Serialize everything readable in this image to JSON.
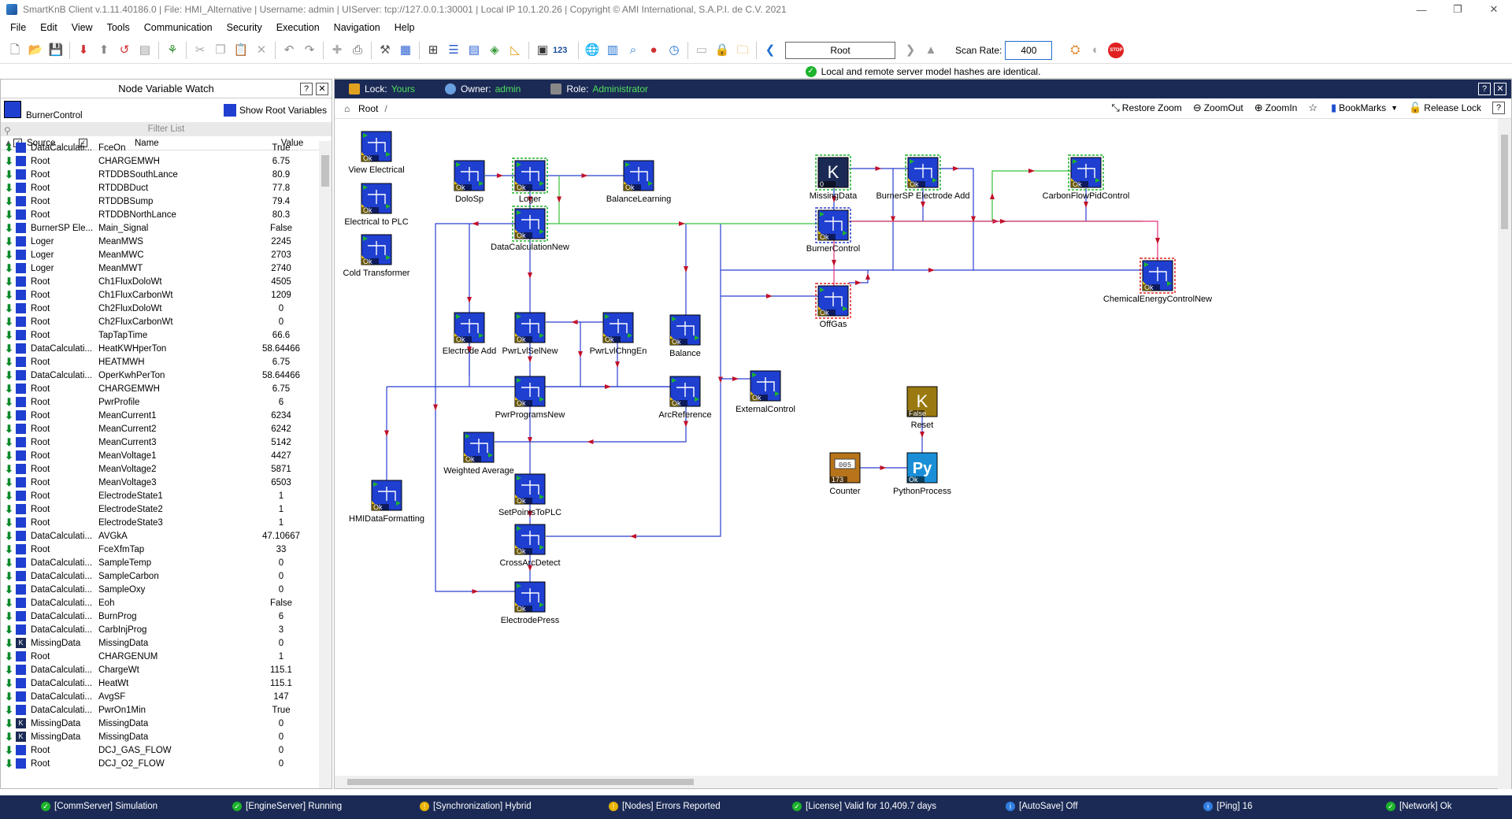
{
  "titlebar": {
    "text": "SmartKnB Client v.1.11.40186.0  |  File: HMI_Alternative  |  Username: admin  |  UIServer: tcp://127.0.0.1:30001  |  Local IP 10.1.20.26  |  Copyright ©  AMI International, S.A.P.I. de C.V. 2021",
    "btn_min": "—",
    "btn_restore": "❐",
    "btn_close": "✕"
  },
  "menu": [
    "File",
    "Edit",
    "View",
    "Tools",
    "Communication",
    "Security",
    "Execution",
    "Navigation",
    "Help"
  ],
  "toolbar": {
    "counter_label": "123",
    "nav_value": "Root",
    "scan_rate_label": "Scan Rate:",
    "scan_rate_value": "400"
  },
  "status_strip": {
    "text": "Local and remote server model hashes are identical."
  },
  "left_panel": {
    "title": "Node Variable Watch",
    "help_btn": "?",
    "close_btn": "✕",
    "node_name": "BurnerControl",
    "show_root": "Show Root Variables",
    "filter": "Filter List",
    "col_source": "Source",
    "col_name": "Name",
    "col_value": "Value",
    "rows": [
      {
        "src": "DataCalculati...",
        "name": "FceOn",
        "val": "True",
        "k": false
      },
      {
        "src": "Root",
        "name": "CHARGEMWH",
        "val": "6.75",
        "k": false
      },
      {
        "src": "Root",
        "name": "RTDDBSouthLance",
        "val": "80.9",
        "k": false
      },
      {
        "src": "Root",
        "name": "RTDDBDuct",
        "val": "77.8",
        "k": false
      },
      {
        "src": "Root",
        "name": "RTDDBSump",
        "val": "79.4",
        "k": false
      },
      {
        "src": "Root",
        "name": "RTDDBNorthLance",
        "val": "80.3",
        "k": false
      },
      {
        "src": "BurnerSP Ele...",
        "name": "Main_Signal",
        "val": "False",
        "k": false
      },
      {
        "src": "Loger",
        "name": "MeanMWS",
        "val": "2245",
        "k": false
      },
      {
        "src": "Loger",
        "name": "MeanMWC",
        "val": "2703",
        "k": false
      },
      {
        "src": "Loger",
        "name": "MeanMWT",
        "val": "2740",
        "k": false
      },
      {
        "src": "Root",
        "name": "Ch1FluxDoloWt",
        "val": "4505",
        "k": false
      },
      {
        "src": "Root",
        "name": "Ch1FluxCarbonWt",
        "val": "1209",
        "k": false
      },
      {
        "src": "Root",
        "name": "Ch2FluxDoloWt",
        "val": "0",
        "k": false
      },
      {
        "src": "Root",
        "name": "Ch2FluxCarbonWt",
        "val": "0",
        "k": false
      },
      {
        "src": "Root",
        "name": "TapTapTime",
        "val": "66.6",
        "k": false
      },
      {
        "src": "DataCalculati...",
        "name": "HeatKWHperTon",
        "val": "58.64466",
        "k": false
      },
      {
        "src": "Root",
        "name": "HEATMWH",
        "val": "6.75",
        "k": false
      },
      {
        "src": "DataCalculati...",
        "name": "OperKwhPerTon",
        "val": "58.64466",
        "k": false
      },
      {
        "src": "Root",
        "name": "CHARGEMWH",
        "val": "6.75",
        "k": false
      },
      {
        "src": "Root",
        "name": "PwrProfile",
        "val": "6",
        "k": false
      },
      {
        "src": "Root",
        "name": "MeanCurrent1",
        "val": "6234",
        "k": false
      },
      {
        "src": "Root",
        "name": "MeanCurrent2",
        "val": "6242",
        "k": false
      },
      {
        "src": "Root",
        "name": "MeanCurrent3",
        "val": "5142",
        "k": false
      },
      {
        "src": "Root",
        "name": "MeanVoltage1",
        "val": "4427",
        "k": false
      },
      {
        "src": "Root",
        "name": "MeanVoltage2",
        "val": "5871",
        "k": false
      },
      {
        "src": "Root",
        "name": "MeanVoltage3",
        "val": "6503",
        "k": false
      },
      {
        "src": "Root",
        "name": "ElectrodeState1",
        "val": "1",
        "k": false
      },
      {
        "src": "Root",
        "name": "ElectrodeState2",
        "val": "1",
        "k": false
      },
      {
        "src": "Root",
        "name": "ElectrodeState3",
        "val": "1",
        "k": false
      },
      {
        "src": "DataCalculati...",
        "name": "AVGkA",
        "val": "47.10667",
        "k": false
      },
      {
        "src": "Root",
        "name": "FceXfmTap",
        "val": "33",
        "k": false
      },
      {
        "src": "DataCalculati...",
        "name": "SampleTemp",
        "val": "0",
        "k": false
      },
      {
        "src": "DataCalculati...",
        "name": "SampleCarbon",
        "val": "0",
        "k": false
      },
      {
        "src": "DataCalculati...",
        "name": "SampleOxy",
        "val": "0",
        "k": false
      },
      {
        "src": "DataCalculati...",
        "name": "Eoh",
        "val": "False",
        "k": false
      },
      {
        "src": "DataCalculati...",
        "name": "BurnProg",
        "val": "6",
        "k": false
      },
      {
        "src": "DataCalculati...",
        "name": "CarbInjProg",
        "val": "3",
        "k": false
      },
      {
        "src": "MissingData",
        "name": "MissingData",
        "val": "0",
        "k": true
      },
      {
        "src": "Root",
        "name": "CHARGENUM",
        "val": "1",
        "k": false
      },
      {
        "src": "DataCalculati...",
        "name": "ChargeWt",
        "val": "115.1",
        "k": false
      },
      {
        "src": "DataCalculati...",
        "name": "HeatWt",
        "val": "115.1",
        "k": false
      },
      {
        "src": "DataCalculati...",
        "name": "AvgSF",
        "val": "147",
        "k": false
      },
      {
        "src": "DataCalculati...",
        "name": "PwrOn1Min",
        "val": "True",
        "k": false
      },
      {
        "src": "MissingData",
        "name": "MissingData",
        "val": "0",
        "k": true
      },
      {
        "src": "MissingData",
        "name": "MissingData",
        "val": "0",
        "k": true
      },
      {
        "src": "Root",
        "name": "DCJ_GAS_FLOW",
        "val": "0",
        "k": false
      },
      {
        "src": "Root",
        "name": "DCJ_O2_FLOW",
        "val": "0",
        "k": false
      }
    ]
  },
  "lockbar": {
    "lock_label": "Lock:",
    "lock_value": "Yours",
    "owner_label": "Owner:",
    "owner_value": "admin",
    "role_label": "Role:",
    "role_value": "Administrator",
    "help_btn": "?",
    "close_btn": "✕"
  },
  "breadcrumb": {
    "root": "Root",
    "sep": "/",
    "restore_zoom": "Restore Zoom",
    "zoom_out": "ZoomOut",
    "zoom_in": "ZoomIn",
    "bookmarks": "BookMarks",
    "release_lock": "Release Lock",
    "help": "?"
  },
  "diagram": {
    "colors": {
      "node_blue": "#1f3fd0",
      "wire_blue": "#2a3fd0",
      "wire_green": "#39c23a",
      "wire_pink": "#e0307a",
      "arrow_red": "#c0102a"
    },
    "nodes": [
      {
        "id": "view-electrical",
        "label": "View Electrical",
        "badge": "Ok",
        "kind": "std"
      },
      {
        "id": "electrical-to-plc",
        "label": "Electrical to PLC",
        "badge": "Ok",
        "kind": "std"
      },
      {
        "id": "cold-transformer",
        "label": "Cold Transformer",
        "badge": "Ok",
        "kind": "std"
      },
      {
        "id": "dolosp",
        "label": "DoloSp",
        "badge": "Ok",
        "kind": "std"
      },
      {
        "id": "loger",
        "label": "Loger",
        "badge": "Ok",
        "kind": "std",
        "border": "green"
      },
      {
        "id": "balance-learning",
        "label": "BalanceLearning",
        "badge": "Ok",
        "kind": "std"
      },
      {
        "id": "data-calc-new",
        "label": "DataCalculationNew",
        "badge": "Ok",
        "kind": "std",
        "border": "green"
      },
      {
        "id": "missing-data",
        "label": "MissingData",
        "badge": "0",
        "kind": "k",
        "border": "green"
      },
      {
        "id": "burnersp-electrode-add",
        "label": "BurnerSP Electrode Add",
        "badge": "Ok",
        "kind": "std",
        "border": "green"
      },
      {
        "id": "carbonflow-pid",
        "label": "CarbonFlowPidControl",
        "badge": "Ok",
        "kind": "std",
        "border": "green"
      },
      {
        "id": "burner-control",
        "label": "BurnerControl",
        "badge": "Ok",
        "kind": "std",
        "border": "blue"
      },
      {
        "id": "chem-energy",
        "label": "ChemicalEnergyControlNew",
        "badge": "Ok",
        "kind": "std",
        "border": "red"
      },
      {
        "id": "offgas",
        "label": "OffGas",
        "badge": "Ok",
        "kind": "std",
        "border": "red"
      },
      {
        "id": "electrode-add",
        "label": "Electrode Add",
        "badge": "Ok",
        "kind": "std"
      },
      {
        "id": "pwrlvlselnew",
        "label": "PwrLvlSelNew",
        "badge": "Ok",
        "kind": "std"
      },
      {
        "id": "pwrlvlchngen",
        "label": "PwrLvlChngEn",
        "badge": "Ok",
        "kind": "std"
      },
      {
        "id": "balance",
        "label": "Balance",
        "badge": "Ok",
        "kind": "std"
      },
      {
        "id": "pwrprogramsnew",
        "label": "PwrProgramsNew",
        "badge": "Ok",
        "kind": "std"
      },
      {
        "id": "arcreference",
        "label": "ArcReference",
        "badge": "Ok",
        "kind": "std"
      },
      {
        "id": "external-control",
        "label": "ExternalControl",
        "badge": "Ok",
        "kind": "std"
      },
      {
        "id": "weighted-average",
        "label": "Weighted Average",
        "badge": "Ok",
        "kind": "std"
      },
      {
        "id": "hmi-data-formatting",
        "label": "HMIDataFormatting",
        "badge": "Ok",
        "kind": "std"
      },
      {
        "id": "setpoints-to-plc",
        "label": "SetPointsToPLC",
        "badge": "Ok",
        "kind": "std"
      },
      {
        "id": "cross-arc-detect",
        "label": "CrossArcDetect",
        "badge": "Ok",
        "kind": "std"
      },
      {
        "id": "electrode-press",
        "label": "ElectrodePress",
        "badge": "Ok",
        "kind": "std"
      },
      {
        "id": "reset",
        "label": "Reset",
        "badge": "False",
        "kind": "kgold"
      },
      {
        "id": "counter",
        "label": "Counter",
        "badge": "173",
        "kind": "counter",
        "counter_text": "005"
      },
      {
        "id": "python-process",
        "label": "PythonProcess",
        "badge": "Ok",
        "kind": "py",
        "py_text": "Py"
      }
    ]
  },
  "statusbar": [
    {
      "text": "[CommServer] Simulation",
      "color": "green"
    },
    {
      "text": "[EngineServer] Running",
      "color": "green"
    },
    {
      "text": "[Synchronization] Hybrid",
      "color": "yellow"
    },
    {
      "text": "[Nodes] Errors Reported",
      "color": "yellow"
    },
    {
      "text": "[License] Valid for 10,409.7 days",
      "color": "green"
    },
    {
      "text": "[AutoSave] Off",
      "color": "blue"
    },
    {
      "text": "[Ping] 16",
      "color": "blue"
    },
    {
      "text": "[Network] Ok",
      "color": "green"
    }
  ]
}
